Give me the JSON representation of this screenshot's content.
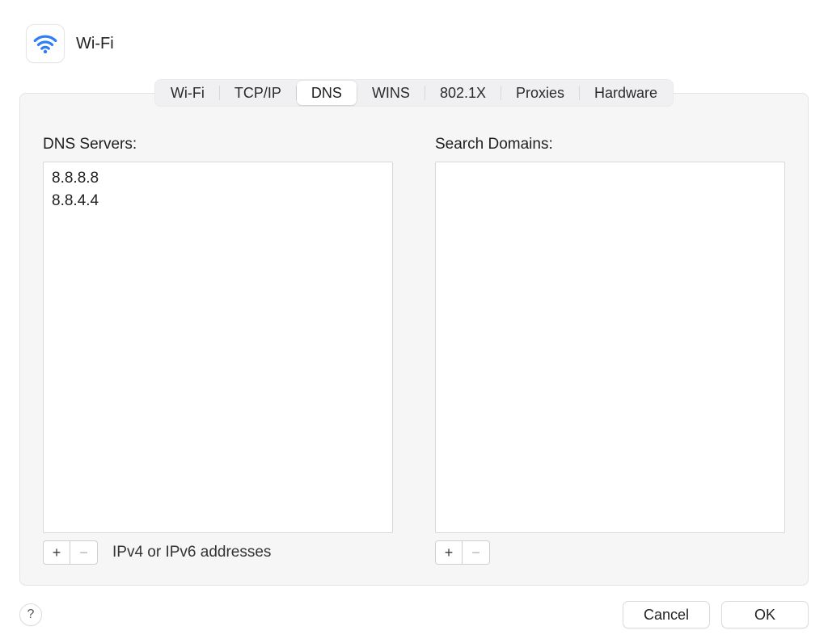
{
  "header": {
    "title": "Wi-Fi"
  },
  "tabs": {
    "wifi": "Wi-Fi",
    "tcpip": "TCP/IP",
    "dns": "DNS",
    "wins": "WINS",
    "dot1x": "802.1X",
    "proxies": "Proxies",
    "hardware": "Hardware"
  },
  "dnsPanel": {
    "serversLabel": "DNS Servers:",
    "servers": [
      "8.8.8.8",
      "8.8.4.4"
    ],
    "searchDomainsLabel": "Search Domains:",
    "searchDomains": [],
    "hint": "IPv4 or IPv6 addresses"
  },
  "buttons": {
    "plus": "+",
    "minus": "−",
    "help": "?",
    "cancel": "Cancel",
    "ok": "OK"
  }
}
